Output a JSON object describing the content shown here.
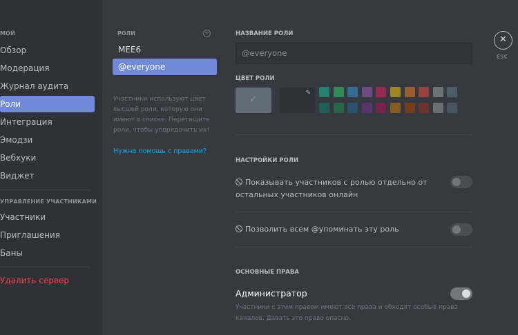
{
  "sidebar": {
    "category1": "МОЙ",
    "items": [
      {
        "label": "Обзор"
      },
      {
        "label": "Модерация"
      },
      {
        "label": "Журнал аудита"
      },
      {
        "label": "Роли"
      },
      {
        "label": "Интеграция"
      },
      {
        "label": "Эмодзи"
      },
      {
        "label": "Вебхуки"
      },
      {
        "label": "Виджет"
      }
    ],
    "category2": "УПРАВЛЕНИЕ УЧАСТНИКАМИ",
    "members_items": [
      {
        "label": "Участники"
      },
      {
        "label": "Приглашения"
      },
      {
        "label": "Баны"
      }
    ],
    "delete_label": "Удалить сервер"
  },
  "roles": {
    "header": "РОЛИ",
    "add_icon": "plus-circle-icon",
    "list": [
      {
        "name": "MEE6"
      },
      {
        "name": "@everyone"
      }
    ],
    "info": "Участники используют цвет высшей роли, которую они имеют в списке. Перетащите роли, чтобы упорядочить их!",
    "help_link": "Нужна помощь с правами?"
  },
  "editor": {
    "name_title": "НАЗВАНИЕ РОЛИ",
    "name_value": "@everyone",
    "color_title": "ЦВЕТ РОЛИ",
    "colors_row1": [
      "#1abc9c",
      "#2ecc71",
      "#3498db",
      "#9b59b6",
      "#e91e63",
      "#f1c40f",
      "#e67e22",
      "#e74c3c",
      "#95a5a6",
      "#607d8b"
    ],
    "colors_row2": [
      "#11806a",
      "#1f8b4c",
      "#206694",
      "#71368a",
      "#ad1457",
      "#c27c0e",
      "#a84300",
      "#992d22",
      "#979c9f",
      "#546e7a"
    ],
    "settings_title": "НАСТРОЙКИ РОЛИ",
    "option_hoist": "Показывать участников с ролью отдельно от остальных участников онлайн",
    "option_mention": "Позволить всем @упоминать эту роль",
    "permissions_title": "ОСНОВНЫЕ ПРАВА",
    "admin_label": "Администратор",
    "admin_desc": "Участники с этим правом имеют все права и обходят особые права каналов. Давать это право опасно."
  },
  "close": {
    "icon": "close-icon",
    "label": "ESC"
  }
}
